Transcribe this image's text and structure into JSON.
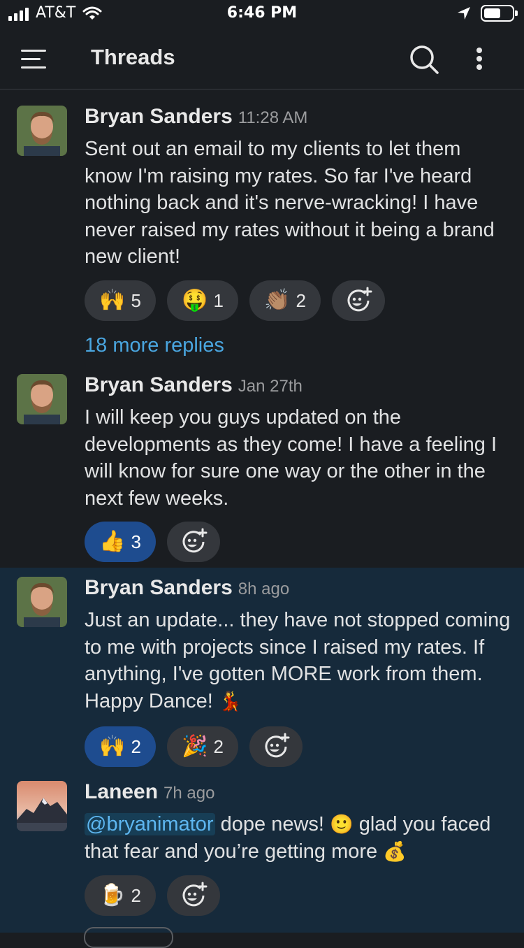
{
  "status_bar": {
    "carrier": "AT&T",
    "time": "6:46 PM"
  },
  "header": {
    "title": "Threads"
  },
  "messages": [
    {
      "author": "Bryan Sanders",
      "time": "11:28 AM",
      "text": "Sent out an email to my clients to let them know I'm raising my rates. So far I've heard nothing back and it's nerve-wracking! I have never raised my rates without it being a brand new client!",
      "reactions": [
        {
          "emoji": "🙌",
          "count": "5"
        },
        {
          "emoji": "🤑",
          "count": "1"
        },
        {
          "emoji": "👏🏽",
          "count": "2"
        }
      ],
      "more_replies": "18 more replies"
    },
    {
      "author": "Bryan Sanders",
      "time": "Jan 27th",
      "text": "I will keep you guys updated on the developments as they come! I have a feeling I will know for  sure one way or the other in the next few weeks.",
      "reactions": [
        {
          "emoji": "👍",
          "count": "3"
        }
      ]
    },
    {
      "author": "Bryan Sanders",
      "time": "8h ago",
      "text": "Just an update... they have not stopped coming to me with projects since I raised my rates. If anything, I've gotten MORE work from them. Happy Dance!",
      "text_emoji": "💃",
      "reactions": [
        {
          "emoji": "🙌",
          "count": "2"
        },
        {
          "emoji": "🎉",
          "count": "2"
        }
      ]
    },
    {
      "author": "Laneen",
      "time": "7h ago",
      "mention": "@bryanimator",
      "text_a": " dope news! ",
      "emoji_a": "🙂",
      "text_b": " glad you faced that fear and you’re getting more ",
      "emoji_b": "💰",
      "reactions": [
        {
          "emoji": "🍺",
          "count": "2"
        }
      ]
    }
  ],
  "icons": {
    "menu": "hamburger-icon",
    "search": "search-icon",
    "more": "more-vertical-icon",
    "add_reaction": "add-reaction-icon"
  },
  "colors": {
    "background": "#1a1d21",
    "highlight": "#162a3b",
    "link": "#4aa6e0",
    "reaction_selected": "#1e4c8f",
    "reaction": "#34373c"
  }
}
